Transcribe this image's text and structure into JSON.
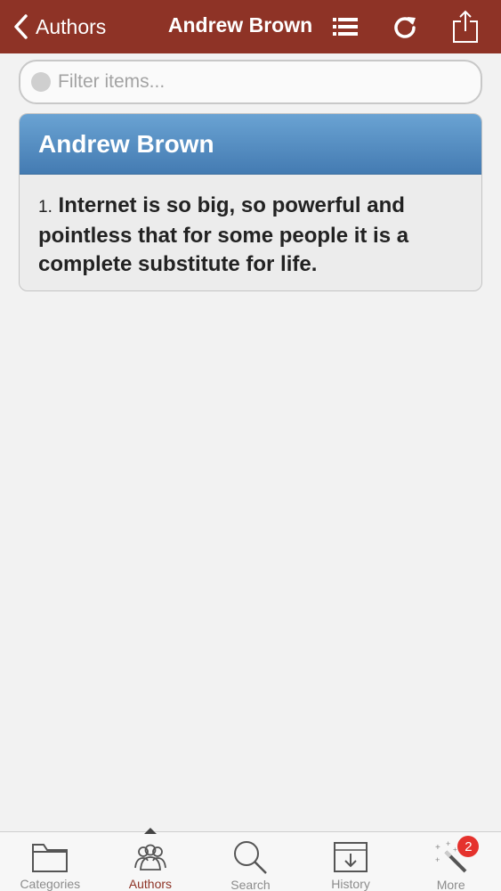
{
  "nav": {
    "back_label": "Authors",
    "title": "Andrew Brown",
    "icons": [
      "chevron-left-icon",
      "list-icon",
      "refresh-icon",
      "share-icon"
    ],
    "bar_color": "#8e3326"
  },
  "filter": {
    "placeholder": "Filter items...",
    "value": ""
  },
  "author_card": {
    "name": "Andrew Brown",
    "header_color": "#5b93c7",
    "quotes": [
      {
        "number": "1.",
        "text": "Internet is so big, so powerful and pointless that for some people it is a complete substitute for life."
      }
    ]
  },
  "tabbar": {
    "tabs": [
      {
        "label": "Categories",
        "icon": "folder-icon"
      },
      {
        "label": "Authors",
        "icon": "people-icon",
        "active": true
      },
      {
        "label": "Search",
        "icon": "search-icon"
      },
      {
        "label": "History",
        "icon": "history-inbox-icon"
      },
      {
        "label": "More",
        "icon": "magic-wand-icon",
        "badge": "2"
      }
    ],
    "active_color": "#8e3326",
    "badge_color": "#e5322d"
  }
}
